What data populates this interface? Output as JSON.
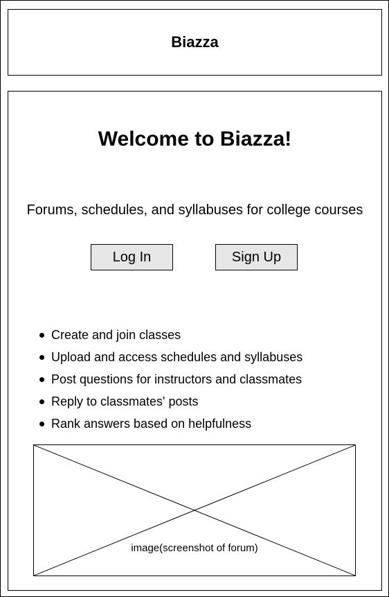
{
  "header": {
    "app_title": "Biazza"
  },
  "main": {
    "welcome_heading": "Welcome to Biazza!",
    "tagline": "Forums, schedules, and syllabuses for college courses",
    "buttons": {
      "login_label": "Log In",
      "signup_label": "Sign Up"
    },
    "features": [
      "Create and join classes",
      "Upload and access schedules and syllabuses",
      "Post questions for instructors and classmates",
      "Reply to classmates' posts",
      "Rank answers based on helpfulness"
    ],
    "image_placeholder": {
      "label": "image(screenshot of forum)"
    }
  },
  "colors": {
    "border": "#000000",
    "button_background": "#e6e6e6",
    "page_background": "#ffffff"
  }
}
